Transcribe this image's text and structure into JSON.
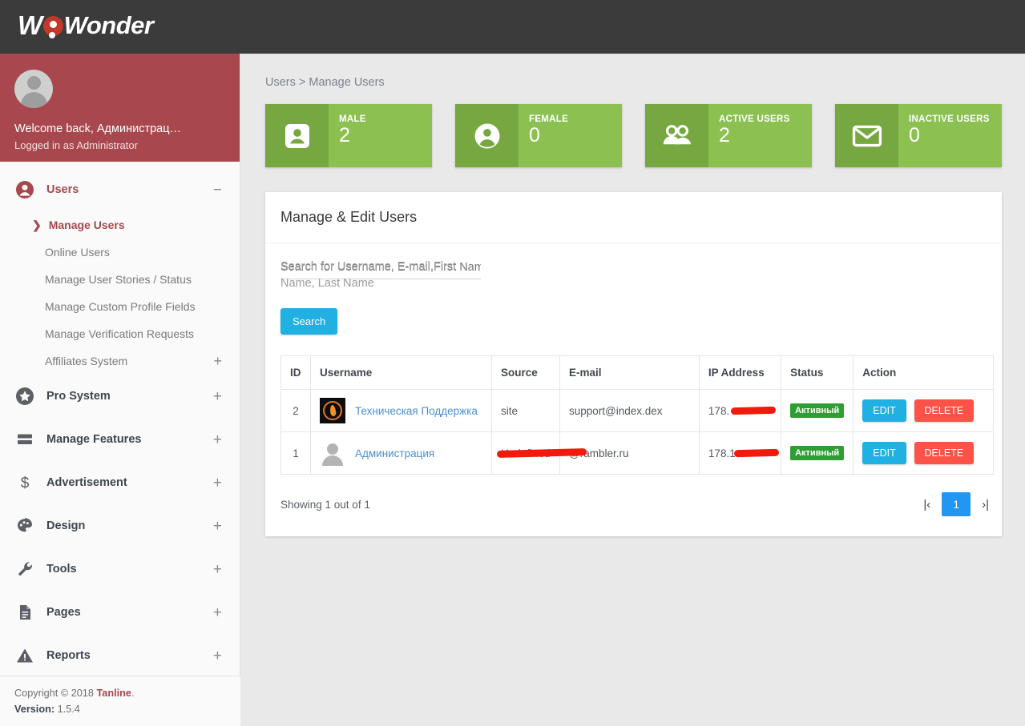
{
  "topbar": {
    "logo_w": "W",
    "logo_rest": "Wonder",
    "logo_icon": "wowonder-logo"
  },
  "sidebar": {
    "user": {
      "welcome": "Welcome back, Администрац…",
      "role": "Logged in as Administrator"
    },
    "nav": [
      {
        "label": "Users",
        "icon": "user-circle-icon",
        "toggle": "−",
        "active": true,
        "children": [
          {
            "label": "Manage Users",
            "selected": true
          },
          {
            "label": "Online Users",
            "selected": false
          },
          {
            "label": "Manage User Stories / Status",
            "selected": false
          },
          {
            "label": "Manage Custom Profile Fields",
            "selected": false
          },
          {
            "label": "Manage Verification Requests",
            "selected": false
          },
          {
            "label": "Affiliates System",
            "selected": false,
            "plus": "+"
          }
        ]
      },
      {
        "label": "Pro System",
        "icon": "star-circle-icon",
        "toggle": "+",
        "children": []
      },
      {
        "label": "Manage Features",
        "icon": "layers-icon",
        "toggle": "+",
        "children": []
      },
      {
        "label": "Advertisement",
        "icon": "dollar-icon",
        "toggle": "+",
        "children": []
      },
      {
        "label": "Design",
        "icon": "palette-icon",
        "toggle": "+",
        "children": []
      },
      {
        "label": "Tools",
        "icon": "wrench-icon",
        "toggle": "+",
        "children": []
      },
      {
        "label": "Pages",
        "icon": "document-icon",
        "toggle": "+",
        "children": []
      },
      {
        "label": "Reports",
        "icon": "warning-triangle-icon",
        "toggle": "+",
        "children": []
      }
    ],
    "footer": {
      "copyright_prefix": "Copyright © 2018 ",
      "brand": "Tanline",
      "copyright_suffix": ".",
      "version_label": "Version:",
      "version_value": "1.5.4"
    }
  },
  "main": {
    "breadcrumb": "Users > Manage Users",
    "cards": [
      {
        "title": "MALE",
        "value": "2",
        "icon": "account-box-icon"
      },
      {
        "title": "FEMALE",
        "value": "0",
        "icon": "account-circle-icon"
      },
      {
        "title": "ACTIVE USERS",
        "value": "2",
        "icon": "people-icon"
      },
      {
        "title": "INACTIVE USERS",
        "value": "0",
        "icon": "envelope-icon"
      }
    ],
    "panel": {
      "title": "Manage & Edit Users",
      "search": {
        "placeholder": "Search for Username, E-mail,First Name, Last Name",
        "value": "",
        "button_label": "Search"
      },
      "table": {
        "headers": [
          "ID",
          "Username",
          "Source",
          "E-mail",
          "IP Address",
          "Status",
          "Action"
        ],
        "rows": [
          {
            "id": "2",
            "username": "Техническая Поддержка",
            "avatar": "fire-avatar",
            "source": "site",
            "email": "support@index.dex",
            "email_redacted": false,
            "ip": "178.",
            "ip_redacted": true,
            "status": "Активный",
            "edit_label": "EDIT",
            "delete_label": "DELETE"
          },
          {
            "id": "1",
            "username": "Администрация",
            "avatar": "default-avatar",
            "source": "Undefined",
            "email": "@rambler.ru",
            "email_redacted": true,
            "ip": "178.1",
            "ip_redacted": true,
            "status": "Активный",
            "edit_label": "EDIT",
            "delete_label": "DELETE"
          }
        ]
      },
      "footer": {
        "showing": "Showing 1 out of 1",
        "first_page": "|‹",
        "current_page": "1",
        "last_page": "›|"
      }
    }
  },
  "colors": {
    "topbar": "#3b3b3b",
    "sidebar_user": "#a8484e",
    "accent_red": "#a8484e",
    "card_green": "#8cc152",
    "card_green_dark": "#77a740",
    "blue": "#21b0e2",
    "red": "#fc5247",
    "badge_green": "#2e9e32",
    "page_blue": "#2196f3",
    "redaction": "#f01b0d"
  }
}
